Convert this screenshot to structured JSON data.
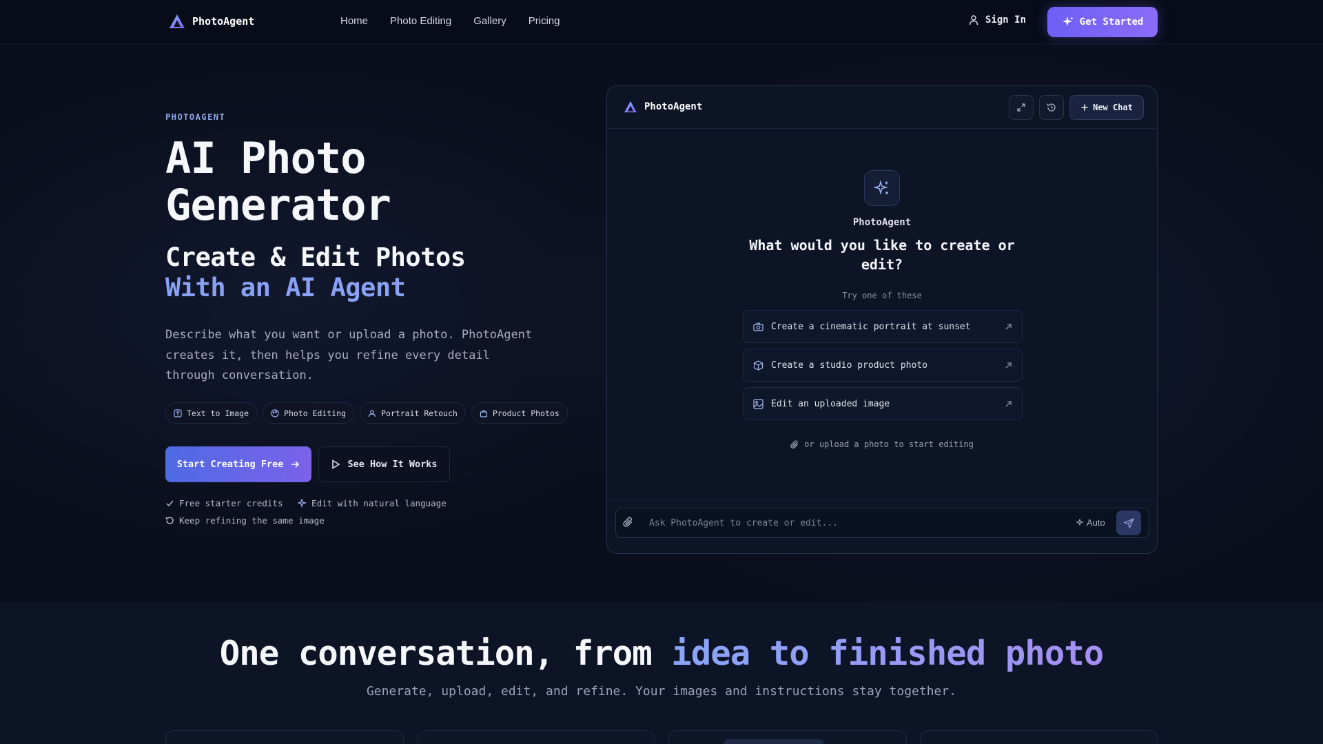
{
  "nav": {
    "brand": "PhotoAgent",
    "links": [
      "Home",
      "Photo Editing",
      "Gallery",
      "Pricing"
    ],
    "sign_in": "Sign In",
    "get_started": "Get Started"
  },
  "hero": {
    "eyebrow": "PHOTOAGENT",
    "title_line1": "AI Photo",
    "title_line2": "Generator",
    "subtitle_line1": "Create & Edit Photos",
    "subtitle_line2": "With an AI Agent",
    "description": "Describe what you want or upload a photo. PhotoAgent creates it, then helps you refine every detail through conversation.",
    "chips": [
      "Text to Image",
      "Photo Editing",
      "Portrait Retouch",
      "Product Photos"
    ],
    "primary_cta": "Start Creating Free",
    "secondary_cta": "See How It Works",
    "perks": [
      "Free starter credits",
      "Edit with natural language",
      "Keep refining the same image"
    ]
  },
  "chat": {
    "header_title": "PhotoAgent",
    "new_chat": "New Chat",
    "agent_name": "PhotoAgent",
    "prompt_title": "What would you like to create or edit?",
    "try_label": "Try one of these",
    "suggestions": [
      "Create a cinematic portrait at sunset",
      "Create a studio product photo",
      "Edit an uploaded image"
    ],
    "upload_hint": "or upload a photo to start editing",
    "input_placeholder": "Ask PhotoAgent to create or edit...",
    "mode": "Auto"
  },
  "section": {
    "title_plain": "One conversation, from ",
    "title_highlight": "idea to finished photo",
    "subtitle": "Generate, upload, edit, and refine. Your images and instructions stay together."
  },
  "colors": {
    "background": "#090d1a",
    "accent": "#6d5ff6",
    "accent_light": "#8aa2f5",
    "panel": "#0d1426"
  },
  "icons": {
    "logo": "triangle-logo-icon",
    "sign_in": "user-icon",
    "get_started": "sparkle-icon",
    "expand": "expand-icon",
    "history": "history-icon",
    "new_chat": "plus-icon",
    "attach": "paperclip-icon",
    "send": "send-icon"
  }
}
